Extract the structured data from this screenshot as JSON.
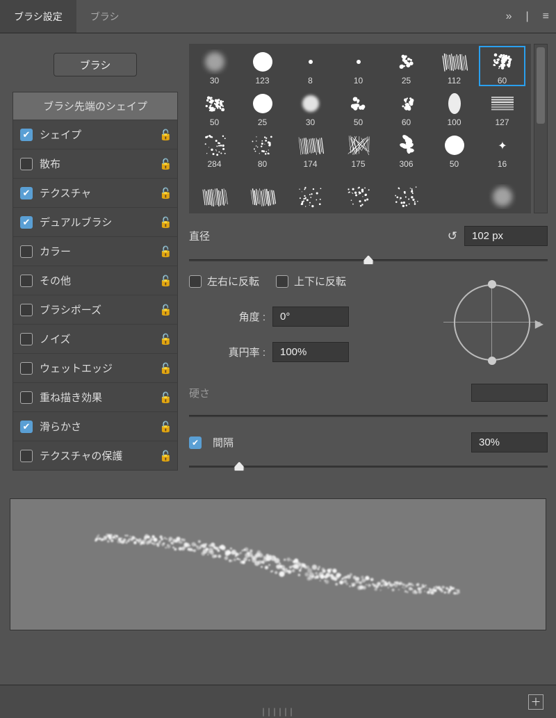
{
  "tabs": {
    "brush_settings": "ブラシ設定",
    "brushes": "ブラシ"
  },
  "expand_icon": "»",
  "menu_icon": "≡",
  "brush_button": "ブラシ",
  "attr_header": "ブラシ先端のシェイプ",
  "attrs": [
    {
      "label": "シェイプ",
      "checked": true
    },
    {
      "label": "散布",
      "checked": false
    },
    {
      "label": "テクスチャ",
      "checked": true
    },
    {
      "label": "デュアルブラシ",
      "checked": true
    },
    {
      "label": "カラー",
      "checked": false
    },
    {
      "label": "その他",
      "checked": false
    },
    {
      "label": "ブラシポーズ",
      "checked": false
    },
    {
      "label": "ノイズ",
      "checked": false
    },
    {
      "label": "ウェットエッジ",
      "checked": false
    },
    {
      "label": "重ね描き効果",
      "checked": false
    },
    {
      "label": "滑らかさ",
      "checked": true
    },
    {
      "label": "テクスチャの保護",
      "checked": false
    }
  ],
  "brushes": [
    {
      "size": "30",
      "type": "soft"
    },
    {
      "size": "123",
      "type": "hard"
    },
    {
      "size": "8",
      "type": "dot"
    },
    {
      "size": "10",
      "type": "dot"
    },
    {
      "size": "25",
      "type": "splat"
    },
    {
      "size": "112",
      "type": "scratch"
    },
    {
      "size": "60",
      "type": "chalk",
      "selected": true
    },
    {
      "size": "50",
      "type": "chalk"
    },
    {
      "size": "25",
      "type": "hard"
    },
    {
      "size": "30",
      "type": "fuzzy"
    },
    {
      "size": "50",
      "type": "splat"
    },
    {
      "size": "60",
      "type": "splat"
    },
    {
      "size": "100",
      "type": "smudge"
    },
    {
      "size": "127",
      "type": "stroke"
    },
    {
      "size": "284",
      "type": "speckle"
    },
    {
      "size": "80",
      "type": "speckle"
    },
    {
      "size": "174",
      "type": "scratch"
    },
    {
      "size": "175",
      "type": "rain"
    },
    {
      "size": "306",
      "type": "leaf"
    },
    {
      "size": "50",
      "type": "hard"
    },
    {
      "size": "16",
      "type": "star"
    },
    {
      "size": "",
      "type": "scratch"
    },
    {
      "size": "",
      "type": "scratch"
    },
    {
      "size": "",
      "type": "speckle"
    },
    {
      "size": "",
      "type": "speckle"
    },
    {
      "size": "",
      "type": "speckle"
    },
    {
      "size": "",
      "type": "blank"
    },
    {
      "size": "",
      "type": "soft"
    }
  ],
  "diameter": {
    "label": "直径",
    "value": "102 px",
    "pos": 50
  },
  "flip_x": "左右に反転",
  "flip_y": "上下に反転",
  "angle": {
    "label": "角度 :",
    "value": "0°"
  },
  "roundness": {
    "label": "真円率 :",
    "value": "100%"
  },
  "hardness_label": "硬さ",
  "spacing": {
    "label": "間隔",
    "value": "30%",
    "checked": true,
    "pos": 14
  }
}
